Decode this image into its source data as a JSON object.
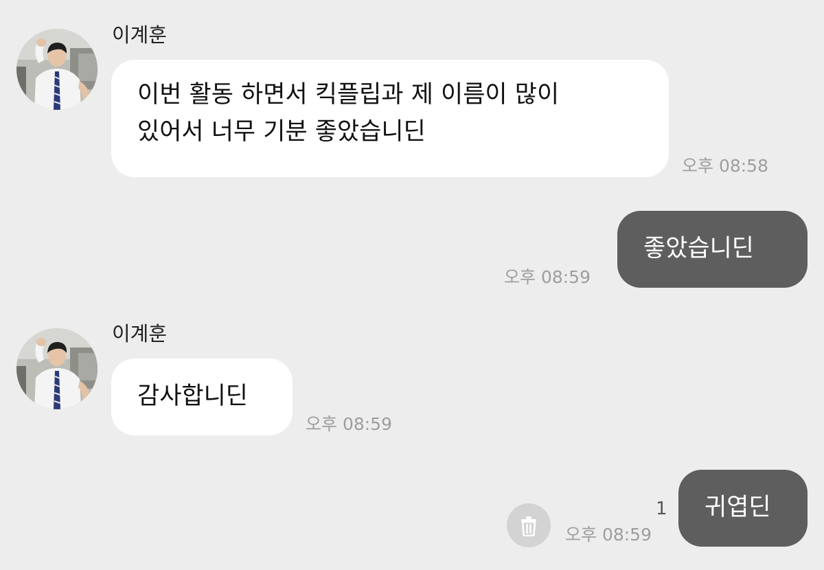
{
  "messages": [
    {
      "direction": "incoming",
      "sender": "이계훈",
      "lines": [
        "이번 활동 하면서 킥플립과 제 이름이 많이",
        "있어서 너무 기분 좋았습니딘"
      ],
      "time": "오후 08:58"
    },
    {
      "direction": "outgoing",
      "lines": [
        "좋았습니딘"
      ],
      "time": "오후 08:59"
    },
    {
      "direction": "incoming",
      "sender": "이계훈",
      "lines": [
        "감사합니딘"
      ],
      "time": "오후 08:59"
    },
    {
      "direction": "outgoing",
      "lines": [
        "귀엽딘"
      ],
      "time": "오후 08:59",
      "unread_count": "1",
      "action_icon": "trash-icon"
    }
  ],
  "colors": {
    "background": "#ededed",
    "incoming_bubble": "#ffffff",
    "outgoing_bubble": "#5e5e5e",
    "outgoing_text": "#ffffff",
    "timestamp": "#9e9e9e"
  }
}
